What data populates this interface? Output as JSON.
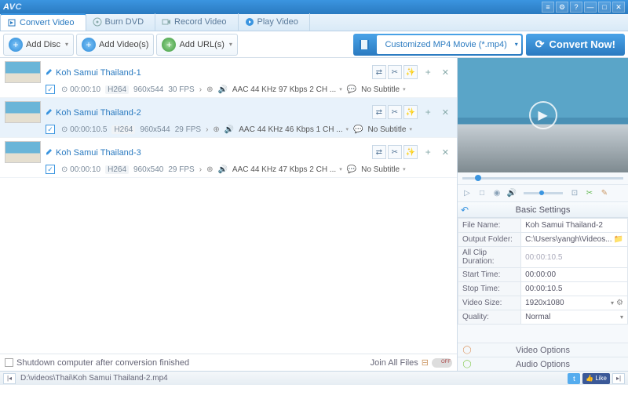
{
  "app": {
    "logo": "AVC"
  },
  "window_buttons": [
    "⊞",
    "⚙",
    "?",
    "—",
    "□",
    "✕"
  ],
  "tabs": [
    {
      "label": "Convert Video",
      "icon": "convert-icon",
      "active": true
    },
    {
      "label": "Burn DVD",
      "icon": "disc-icon",
      "active": false
    },
    {
      "label": "Record Video",
      "icon": "record-icon",
      "active": false
    },
    {
      "label": "Play Video",
      "icon": "play-icon",
      "active": false
    }
  ],
  "toolbar": {
    "add_disc": "Add Disc",
    "add_videos": "Add Video(s)",
    "add_urls": "Add URL(s)",
    "profile": "Customized MP4 Movie (*.mp4)",
    "convert": "Convert Now!"
  },
  "items": [
    {
      "name": "Koh Samui Thailand-1",
      "dur": "00:00:10",
      "codec": "H264",
      "res": "960x544",
      "fps": "30 FPS",
      "audio": "AAC 44 KHz 97 Kbps 2 CH ...",
      "subtitle": "No Subtitle",
      "selected": false,
      "checked": true
    },
    {
      "name": "Koh Samui Thailand-2",
      "dur": "00:00:10.5",
      "codec": "H264",
      "res": "960x544",
      "fps": "29 FPS",
      "audio": "AAC 44 KHz 46 Kbps 1 CH ...",
      "subtitle": "No Subtitle",
      "selected": true,
      "checked": true
    },
    {
      "name": "Koh Samui Thailand-3",
      "dur": "00:00:10",
      "codec": "H264",
      "res": "960x540",
      "fps": "29 FPS",
      "audio": "AAC 44 KHz 47 Kbps 2 CH ...",
      "subtitle": "No Subtitle",
      "selected": false,
      "checked": true
    }
  ],
  "left_footer": {
    "shutdown": "Shutdown computer after conversion finished",
    "join": "Join All Files"
  },
  "preview": {
    "title": "Koh Samui Thailand-2"
  },
  "settings": {
    "header": "Basic Settings",
    "rows": {
      "file_name_l": "File Name:",
      "file_name": "Koh Samui Thailand-2",
      "output_l": "Output Folder:",
      "output": "C:\\Users\\yangh\\Videos...",
      "clip_l": "All Clip Duration:",
      "clip": "00:00:10.5",
      "start_l": "Start Time:",
      "start": "00:00:00",
      "stop_l": "Stop Time:",
      "stop": "00:00:10.5",
      "size_l": "Video Size:",
      "size": "1920x1080",
      "quality_l": "Quality:",
      "quality": "Normal"
    }
  },
  "right_options": {
    "video": "Video Options",
    "audio": "Audio Options"
  },
  "status": {
    "path": "D:\\videos\\Thai\\Koh Samui Thailand-2.mp4",
    "fb": "Like"
  }
}
